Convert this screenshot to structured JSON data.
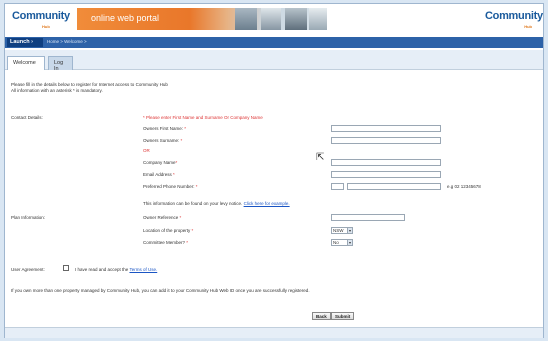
{
  "header": {
    "logo_left": "Community",
    "logo_left_sub": "Hub",
    "banner_title": "online web portal",
    "logo_right": "Community",
    "logo_right_sub": "Hub"
  },
  "navbar": {
    "launch_label": "Launch",
    "breadcrumb": "Home > Welcome >"
  },
  "tabs": [
    {
      "label": "Welcome"
    },
    {
      "label": "Log In"
    }
  ],
  "intro": {
    "line1": "Please fill in the details below to register for Internet access to Community Hub",
    "line2": "All information with an asterisk * is mandatory."
  },
  "contact": {
    "section_label": "Contact Details:",
    "instruction": "Please enter First Name and Surname Or Company Name",
    "first_name_label": "Owners First Name:",
    "surname_label": "Owners Surname:",
    "or_label": "OR",
    "company_label": "Company Name",
    "email_label": "Email Address",
    "phone_label": "Preferred Phone Number:",
    "phone_hint": "e.g 02 12345678",
    "info_text": "This information can be found on your levy notice.",
    "info_link": "Click here for example."
  },
  "plan": {
    "section_label": "Plan Information:",
    "owner_ref_label": "Owner Reference",
    "location_label": "Location of the property",
    "location_value": "NSW",
    "committee_label": "Committee Member?",
    "committee_value": "No"
  },
  "agreement": {
    "label": "User Agreement:",
    "text": "I have read and accept the",
    "link": "Terms of Use."
  },
  "note": "If you own more than one property managed by Community Hub, you can add it to your Community Hub Web ID once you are successfully registered.",
  "buttons": {
    "back": "Back",
    "submit": "Submit"
  }
}
